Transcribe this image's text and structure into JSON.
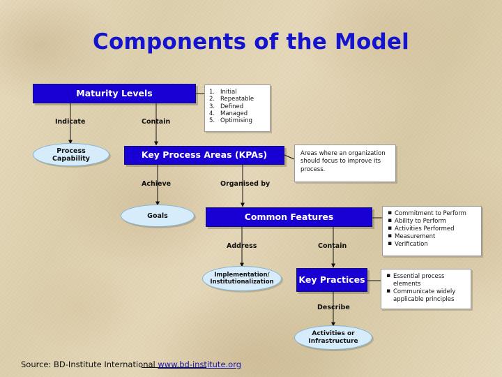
{
  "slide": {
    "title": "Components of the Model",
    "source_prefix": "Source: BD-Institute International",
    "source_link": "www.bd-institute.org"
  },
  "nodes": {
    "maturity_levels": "Maturity Levels",
    "process_capability": "Process\nCapability",
    "kpas": "Key Process Areas (KPAs)",
    "goals": "Goals",
    "common_features": "Common Features",
    "implementation": "Implementation/\nInstitutionalization",
    "key_practices": "Key Practices",
    "activities": "Activities or\nInfrastructure"
  },
  "connectors": [
    {
      "label": "Indicate"
    },
    {
      "label": "Contain"
    },
    {
      "label": "Achieve"
    },
    {
      "label": "Organised by"
    },
    {
      "label": "Address"
    },
    {
      "label": "Contain"
    },
    {
      "label": "Describe"
    }
  ],
  "callouts": {
    "levels_list": [
      {
        "num": "1.",
        "text": "Initial"
      },
      {
        "num": "2.",
        "text": "Repeatable"
      },
      {
        "num": "3.",
        "text": "Defined"
      },
      {
        "num": "4.",
        "text": "Managed"
      },
      {
        "num": "5.",
        "text": "Optimising"
      }
    ],
    "kpa_note": "Areas where an organization should focus to improve its process.",
    "common_features_list": [
      "Commitment to Perform",
      "Ability to Perform",
      "Activities Performed",
      "Measurement",
      "Verification"
    ],
    "key_practices_list": [
      "Essential process elements",
      "Communicate widely applicable principles"
    ]
  },
  "colors": {
    "title": "#1414CF",
    "box_blue": "#1800D4",
    "oval_blue": "#D6ECFB",
    "background": "#E3D6B8"
  }
}
